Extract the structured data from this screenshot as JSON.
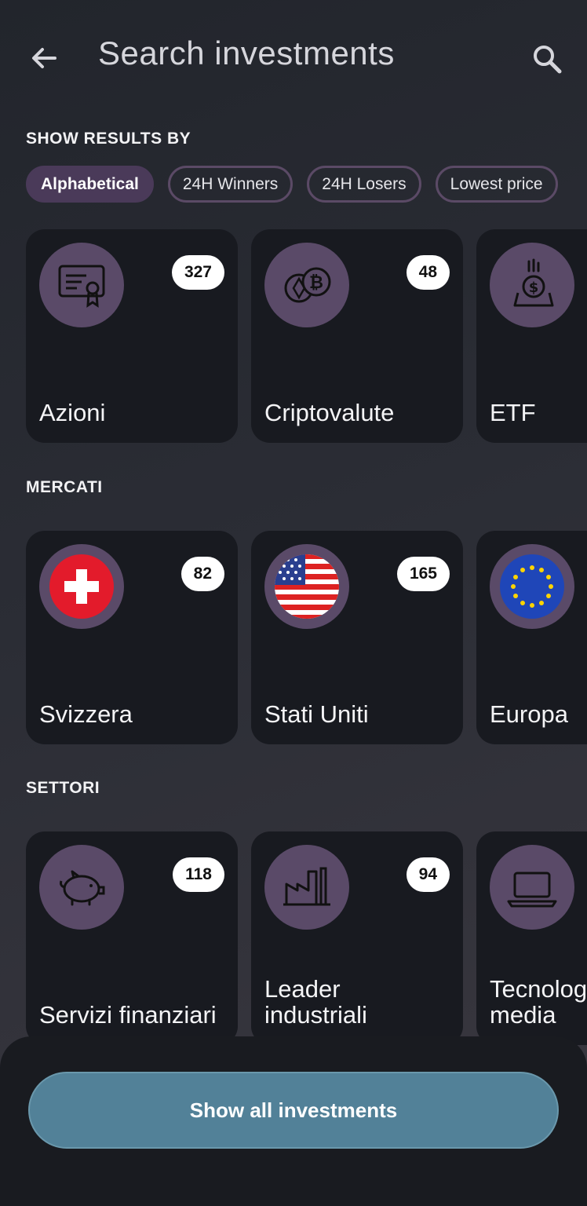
{
  "header": {
    "title": "Search investments",
    "back_icon": "arrow-left-icon",
    "search_icon": "search-icon"
  },
  "sort": {
    "label": "SHOW RESULTS BY",
    "chips": [
      {
        "label": "Alphabetical",
        "active": true
      },
      {
        "label": "24H Winners",
        "active": false
      },
      {
        "label": "24H Losers",
        "active": false
      },
      {
        "label": "Lowest price",
        "active": false
      }
    ]
  },
  "categories": {
    "cards": [
      {
        "label": "Azioni",
        "count": "327",
        "icon": "certificate-icon"
      },
      {
        "label": "Criptovalute",
        "count": "48",
        "icon": "crypto-coins-icon"
      },
      {
        "label": "ETF",
        "count": "",
        "icon": "money-bag-icon"
      }
    ]
  },
  "markets": {
    "label": "MERCATI",
    "cards": [
      {
        "label": "Svizzera",
        "count": "82",
        "icon": "swiss-flag-icon"
      },
      {
        "label": "Stati Uniti",
        "count": "165",
        "icon": "us-flag-icon"
      },
      {
        "label": "Europa",
        "count": "",
        "icon": "eu-flag-icon"
      }
    ]
  },
  "sectors": {
    "label": "SETTORI",
    "cards": [
      {
        "label": "Servizi finanziari",
        "count": "118",
        "icon": "piggy-bank-icon"
      },
      {
        "label": "Leader\nindustriali",
        "count": "94",
        "icon": "factory-icon"
      },
      {
        "label": "Tecnologia\nmedia",
        "count": "",
        "icon": "laptop-icon"
      }
    ]
  },
  "cta": {
    "label": "Show all investments"
  },
  "colors": {
    "accent_purple": "#5a4a68",
    "card_bg": "#181a20",
    "cta": "#528198"
  }
}
